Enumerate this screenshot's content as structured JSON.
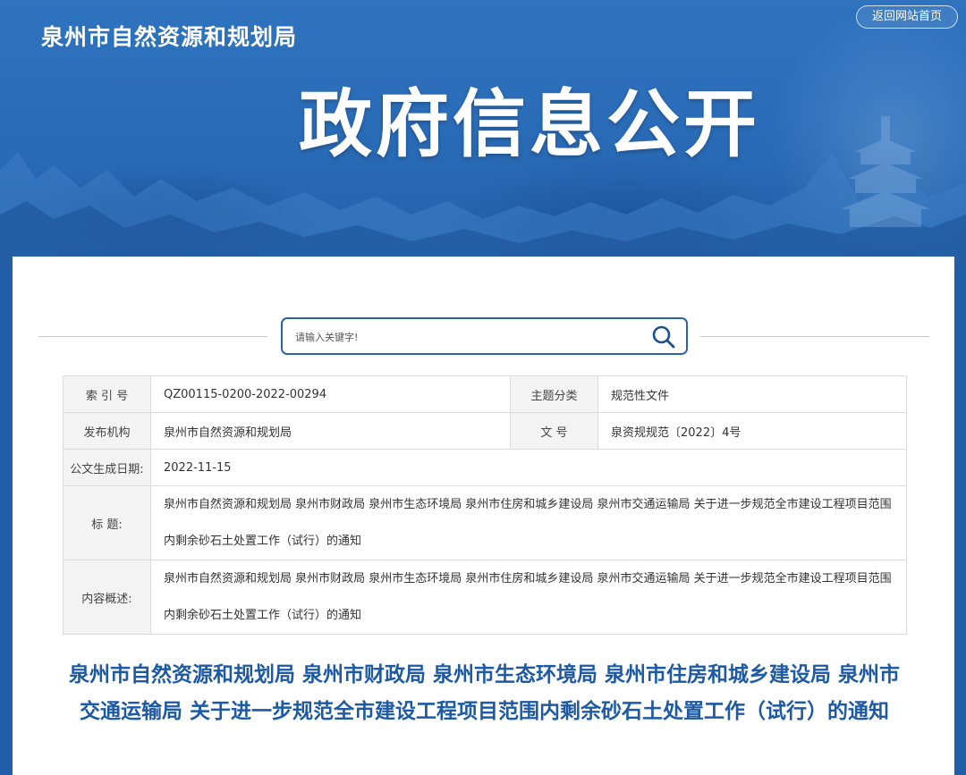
{
  "header": {
    "site_name": "泉州市自然资源和规划局",
    "home_link": "返回网站首页",
    "banner_title": "政府信息公开"
  },
  "search": {
    "placeholder": "请输入关键字!",
    "icon": "search-icon"
  },
  "meta": {
    "index_label": "索 引 号",
    "index_value": "QZ00115-0200-2022-00294",
    "topic_label": "主题分类",
    "topic_value": "规范性文件",
    "publisher_label": "发布机构",
    "publisher_value": "泉州市自然资源和规划局",
    "docno_label": "文 号",
    "docno_value": "泉资规规范〔2022〕4号",
    "date_label": "公文生成日期:",
    "date_value": "2022-11-15",
    "title_label": "标 题:",
    "title_value": "泉州市自然资源和规划局 泉州市财政局 泉州市生态环境局 泉州市住房和城乡建设局 泉州市交通运输局 关于进一步规范全市建设工程项目范围内剩余砂石土处置工作（试行）的通知",
    "summary_label": "内容概述:",
    "summary_value": "泉州市自然资源和规划局 泉州市财政局 泉州市生态环境局 泉州市住房和城乡建设局 泉州市交通运输局 关于进一步规范全市建设工程项目范围内剩余砂石土处置工作（试行）的通知"
  },
  "document": {
    "title": "泉州市自然资源和规划局 泉州市财政局 泉州市生态环境局 泉州市住房和城乡建设局 泉州市交通运输局 关于进一步规范全市建设工程项目范围内剩余砂石土处置工作（试行）的通知"
  },
  "colors": {
    "banner": "#2a6cb8",
    "accent": "#1d5aa3",
    "search_border": "#2b63a9"
  }
}
